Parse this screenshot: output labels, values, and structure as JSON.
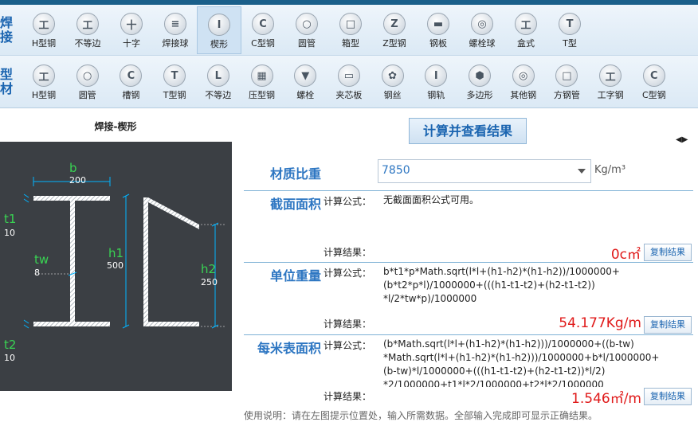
{
  "weld_bar": {
    "label": "焊接",
    "items": [
      {
        "name": "weld-h-steel",
        "label": "H型钢",
        "glyph": "工"
      },
      {
        "name": "weld-unequal-angle",
        "label": "不等边",
        "glyph": "工"
      },
      {
        "name": "weld-cross",
        "label": "十字",
        "glyph": "十"
      },
      {
        "name": "weld-ball",
        "label": "焊接球",
        "glyph": "≡"
      },
      {
        "name": "weld-wedge",
        "label": "楔形",
        "glyph": "I"
      },
      {
        "name": "weld-c-steel",
        "label": "C型钢",
        "glyph": "C"
      },
      {
        "name": "weld-round-tube",
        "label": "圆管",
        "glyph": "○"
      },
      {
        "name": "weld-box",
        "label": "箱型",
        "glyph": "□"
      },
      {
        "name": "weld-z-steel",
        "label": "Z型钢",
        "glyph": "Z"
      },
      {
        "name": "weld-steel-plate",
        "label": "钢板",
        "glyph": "▬"
      },
      {
        "name": "weld-bolt-ball",
        "label": "螺栓球",
        "glyph": "◎"
      },
      {
        "name": "weld-box-shape",
        "label": "盒式",
        "glyph": "工"
      },
      {
        "name": "weld-t-shape",
        "label": "T型",
        "glyph": "T"
      }
    ]
  },
  "profile_bar": {
    "label": "型材",
    "items": [
      {
        "name": "profile-h-steel",
        "label": "H型钢",
        "glyph": "工"
      },
      {
        "name": "profile-round-tube",
        "label": "圆管",
        "glyph": "○"
      },
      {
        "name": "profile-channel",
        "label": "槽钢",
        "glyph": "C"
      },
      {
        "name": "profile-t-steel",
        "label": "T型钢",
        "glyph": "T"
      },
      {
        "name": "profile-unequal-angle",
        "label": "不等边",
        "glyph": "L"
      },
      {
        "name": "profile-deck-plate",
        "label": "压型钢",
        "glyph": "▦"
      },
      {
        "name": "profile-bolt",
        "label": "螺栓",
        "glyph": "▼"
      },
      {
        "name": "profile-sandwich-panel",
        "label": "夹芯板",
        "glyph": "▭"
      },
      {
        "name": "profile-steel-wire",
        "label": "钢丝",
        "glyph": "✿"
      },
      {
        "name": "profile-rail",
        "label": "钢轨",
        "glyph": "I"
      },
      {
        "name": "profile-polygon",
        "label": "多边形",
        "glyph": "⬢"
      },
      {
        "name": "profile-other",
        "label": "其他钢",
        "glyph": "◎"
      },
      {
        "name": "profile-square-tube",
        "label": "方钢管",
        "glyph": "□"
      },
      {
        "name": "profile-i-beam",
        "label": "工字钢",
        "glyph": "工"
      },
      {
        "name": "profile-c-steel",
        "label": "C型钢",
        "glyph": "C"
      }
    ]
  },
  "diagram": {
    "title": "焊接-楔形",
    "b_name": "b",
    "b_value": "200",
    "t1_name": "t1",
    "t1_value": "10",
    "tw_name": "tw",
    "tw_value": "8",
    "h1_name": "h1",
    "h1_value": "500",
    "h2_name": "h2",
    "h2_value": "250",
    "t2_name": "t2",
    "t2_value": "10"
  },
  "actions": {
    "calculate_label": "计算并查看结果",
    "copy_label": "复制结果"
  },
  "material": {
    "label": "材质比重",
    "value": "7850",
    "unit": "Kg/m³"
  },
  "area": {
    "label": "截面面积",
    "formula_label": "计算公式：",
    "formula": "无截面面积公式可用。",
    "result_label": "计算结果：",
    "result": "0c㎡"
  },
  "unit_weight": {
    "label": "单位重量",
    "formula_label": "计算公式：",
    "formula_lines": [
      "b*t1*p*Math.sqrt(l*l+(h1-h2)*(h1-h2))/1000000+",
      "(b*t2*p*l)/1000000+(((h1-t1-t2)+(h2-t1-t2))",
      "*l/2*tw*p)/1000000"
    ],
    "result_label": "计算结果：",
    "result": "54.177Kg/m"
  },
  "surface": {
    "label": "每米表面积",
    "formula_label": "计算公式：",
    "formula_lines": [
      "(b*Math.sqrt(l*l+(h1-h2)*(h1-h2)))/1000000+((b-tw)",
      "*Math.sqrt(l*l+(h1-h2)*(h1-h2)))/1000000+b*l/1000000+",
      "(b-tw)*l/1000000+(((h1-t1-t2)+(h2-t1-t2))*l/2)",
      "*2/1000000+t1*l*2/1000000+t2*l*2/1000000"
    ],
    "result_label": "计算结果：",
    "result": "1.546㎡/m"
  },
  "instructions": "使用说明：请在左图提示位置处，输入所需数据。全部输入完成即可显示正确结果。",
  "colors": {
    "accent": "#2d76c2",
    "result": "#e01919",
    "diagram_bg": "#3b3f44",
    "dim_name": "#39d353"
  }
}
